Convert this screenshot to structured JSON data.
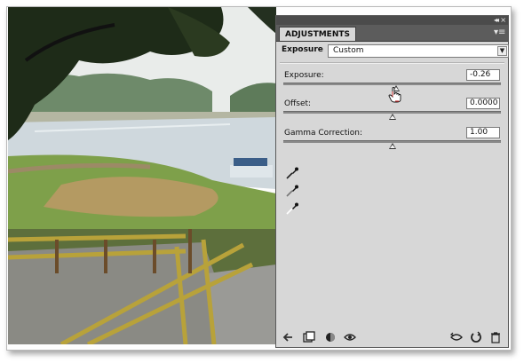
{
  "panel": {
    "tab_label": "ADJUSTMENTS",
    "window_controls": {
      "collapse": "◂◂",
      "close": "×"
    },
    "menu_icon": "panel-menu-icon",
    "adjustment_name": "Exposure",
    "preset": {
      "selected": "Custom"
    }
  },
  "params": {
    "exposure": {
      "label": "Exposure:",
      "value": "-0.26",
      "position": 0.52
    },
    "offset": {
      "label": "Offset:",
      "value": "0.0000",
      "position": 0.5
    },
    "gamma": {
      "label": "Gamma Correction:",
      "value": "1.00",
      "position": 0.5
    }
  },
  "tools": [
    "black-point-eyedropper-icon",
    "gray-point-eyedropper-icon",
    "white-point-eyedropper-icon"
  ],
  "footer_icons": [
    "back-arrow-icon",
    "clip-to-layer-icon",
    "visibility-toggle-icon",
    "eye-preview-icon",
    "previous-state-icon",
    "reset-icon",
    "delete-icon"
  ],
  "colors": {
    "panel_bg": "#d7d7d7",
    "tab_strip": "#5c5c5c",
    "thumb_green": "#2f8f2f"
  }
}
